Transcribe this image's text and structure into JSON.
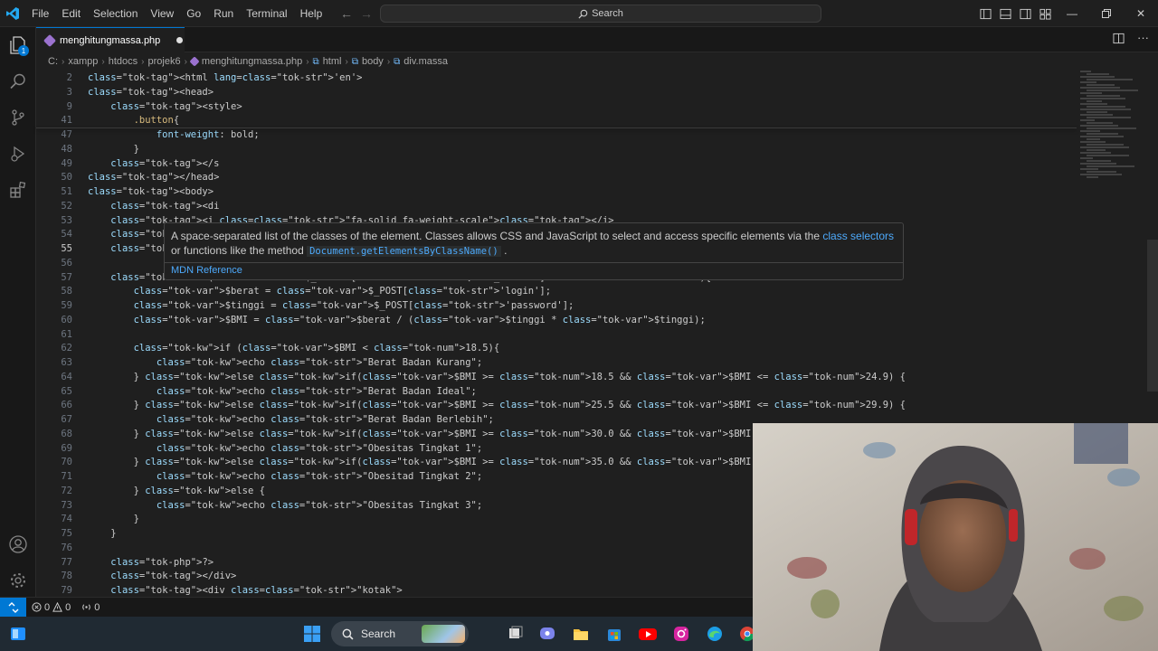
{
  "menu": {
    "items": [
      "File",
      "Edit",
      "Selection",
      "View",
      "Go",
      "Run",
      "Terminal",
      "Help"
    ]
  },
  "search": {
    "label": "Search"
  },
  "tab": {
    "filename": "menghitungmassa.php"
  },
  "breadcrumb": {
    "items": [
      "C:",
      "xampp",
      "htdocs",
      "projek6",
      "menghitungmassa.php",
      "html",
      "body",
      "div.massa"
    ]
  },
  "editor": {
    "active_line": "55",
    "lines": [
      {
        "num": "2",
        "code": "<html lang='en'>"
      },
      {
        "num": "3",
        "code": "<head>"
      },
      {
        "num": "9",
        "code": "    <style>"
      },
      {
        "num": "41",
        "code": "        .button{"
      },
      {
        "num": "47",
        "code": "            font-weight: bold;"
      },
      {
        "num": "48",
        "code": "        }"
      },
      {
        "num": "49",
        "code": "    </s"
      },
      {
        "num": "50",
        "code": "</head>"
      },
      {
        "num": "51",
        "code": "<body>"
      },
      {
        "num": "52",
        "code": "    <di"
      },
      {
        "num": "53",
        "code": "    <i class=\"fa-solid fa-weight-scale\"></i>"
      },
      {
        "num": "54",
        "code": "    <h1>IMT</h1>"
      },
      {
        "num": "55",
        "code": "    <?php"
      },
      {
        "num": "56",
        "code": ""
      },
      {
        "num": "57",
        "code": "    if($_SERVER['REQUEST_METHOD'] === 'POST'){"
      },
      {
        "num": "58",
        "code": "        $berat = $_POST['login'];"
      },
      {
        "num": "59",
        "code": "        $tinggi = $_POST['password'];"
      },
      {
        "num": "60",
        "code": "        $BMI = $berat / ($tinggi * $tinggi);"
      },
      {
        "num": "61",
        "code": ""
      },
      {
        "num": "62",
        "code": "        if ($BMI < 18.5){"
      },
      {
        "num": "63",
        "code": "            echo \"Berat Badan Kurang\";"
      },
      {
        "num": "64",
        "code": "        } else if($BMI >= 18.5 && $BMI <= 24.9) {"
      },
      {
        "num": "65",
        "code": "            echo \"Berat Badan Ideal\";"
      },
      {
        "num": "66",
        "code": "        } else if($BMI >= 25.5 && $BMI <= 29.9) {"
      },
      {
        "num": "67",
        "code": "            echo \"Berat Badan Berlebih\";"
      },
      {
        "num": "68",
        "code": "        } else if($BMI >= 30.0 && $BMI <= 34.9) {"
      },
      {
        "num": "69",
        "code": "            echo \"Obesitas Tingkat 1\";"
      },
      {
        "num": "70",
        "code": "        } else if($BMI >= 35.0 && $BMI <= 39.9) {"
      },
      {
        "num": "71",
        "code": "            echo \"Obesitad Tingkat 2\";"
      },
      {
        "num": "72",
        "code": "        } else {"
      },
      {
        "num": "73",
        "code": "            echo \"Obesitas Tingkat 3\";"
      },
      {
        "num": "74",
        "code": "        }"
      },
      {
        "num": "75",
        "code": "    }"
      },
      {
        "num": "76",
        "code": ""
      },
      {
        "num": "77",
        "code": "    ?>"
      },
      {
        "num": "78",
        "code": "    </div>"
      },
      {
        "num": "79",
        "code": "    <div class=\"kotak\">"
      }
    ]
  },
  "hover": {
    "desc_part1": "A space-separated list of the classes of the element. Classes allows CSS and JavaScript to select and access specific elements via the ",
    "link1": "class selectors",
    "desc_part2": " or functions like the method ",
    "code": "Document.getElementsByClassName()",
    "desc_part3": ".",
    "reference": "MDN Reference"
  },
  "status": {
    "errors": "0",
    "warnings": "0",
    "ports": "0"
  },
  "taskbar": {
    "search_label": "Search"
  },
  "colors": {
    "accent": "#0078d4",
    "background": "#1f1f1f",
    "php_icon": "#9b72cf"
  }
}
